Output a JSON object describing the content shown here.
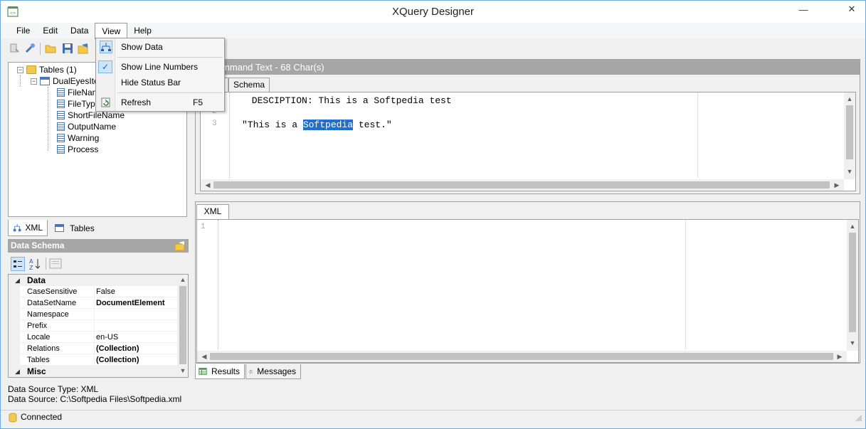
{
  "window": {
    "title": "XQuery Designer",
    "minimize": "—",
    "close": "✕"
  },
  "menu": {
    "items": [
      "File",
      "Edit",
      "Data",
      "View",
      "Help"
    ]
  },
  "view_menu": {
    "show_data": "Show Data",
    "show_line_numbers": "Show Line Numbers",
    "hide_status_bar": "Hide Status Bar",
    "refresh": "Refresh",
    "refresh_shortcut": "F5",
    "show_line_numbers_checked": true
  },
  "tree": {
    "root": "Tables (1)",
    "table": "DualEyesIte",
    "fields": [
      "FileNam",
      "FileTyp",
      "ShortFileName",
      "OutputName",
      "Warning",
      "Process"
    ]
  },
  "left_tabs": {
    "xml": "XML",
    "tables": "Tables"
  },
  "schema": {
    "header": "Data Schema",
    "categories": {
      "data": "Data",
      "misc": "Misc"
    },
    "properties": [
      {
        "name": "CaseSensitive",
        "value": "False",
        "bold": false
      },
      {
        "name": "DataSetName",
        "value": "DocumentElement",
        "bold": true
      },
      {
        "name": "Namespace",
        "value": "",
        "bold": false
      },
      {
        "name": "Prefix",
        "value": "",
        "bold": false
      },
      {
        "name": "Locale",
        "value": "en-US",
        "bold": false
      },
      {
        "name": "Relations",
        "value": "(Collection)",
        "bold": true
      },
      {
        "name": "Tables",
        "value": "(Collection)",
        "bold": true
      }
    ]
  },
  "command": {
    "header": "ry Command Text - 68 Char(s)",
    "tab_schema": "Schema",
    "line_numbers": [
      "1",
      "2",
      "3"
    ],
    "line1": " DESCIPTION: This is a Softpedia test",
    "line3_before": "\"This is a ",
    "line3_highlight": "Softpedia",
    "line3_after": " test.\""
  },
  "xml_panel": {
    "tab": "XML",
    "line_numbers": [
      "1"
    ]
  },
  "bottom_tabs": {
    "results": "Results",
    "messages": "Messages"
  },
  "status": {
    "source_type": "Data Source Type: XML",
    "source": "Data Source: C:\\Softpedia Files\\Softpedia.xml",
    "connection": "Connected"
  },
  "colors": {
    "header_gray": "#a6a6a6",
    "selection": "#1e6fd1",
    "window_border": "#6fa8dc"
  }
}
